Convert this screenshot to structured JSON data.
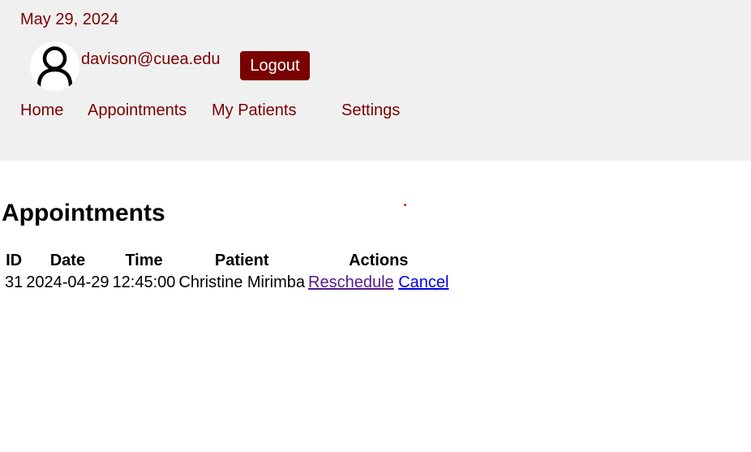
{
  "header": {
    "date": "May 29, 2024",
    "user_email": "davison@cuea.edu",
    "logout_label": "Logout",
    "avatar_icon": "user-icon",
    "colors": {
      "brand": "#7a0000",
      "header_bg": "#f1f0f0"
    }
  },
  "nav": {
    "items": [
      {
        "label": "Home"
      },
      {
        "label": "Appointments"
      },
      {
        "label": "My Patients"
      },
      {
        "label": "Settings"
      }
    ]
  },
  "main": {
    "title": "Appointments",
    "table": {
      "columns": [
        "ID",
        "Date",
        "Time",
        "Patient",
        "Actions"
      ],
      "rows": [
        {
          "id": "31",
          "date": "2024-04-29",
          "time": "12:45:00",
          "patient": "Christine Mirimba",
          "actions": {
            "reschedule": "Reschedule",
            "cancel": "Cancel"
          }
        }
      ]
    }
  }
}
